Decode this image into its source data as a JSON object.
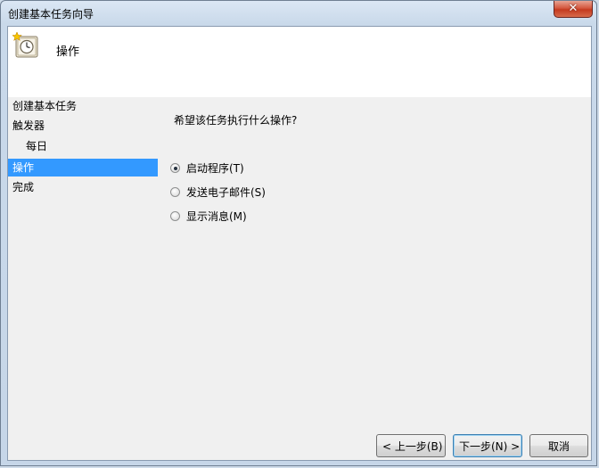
{
  "window": {
    "title": "创建基本任务向导",
    "close_label": "✕"
  },
  "header": {
    "title": "操作",
    "icon": "clock-star-icon"
  },
  "nav": {
    "items": [
      {
        "label": "创建基本任务"
      },
      {
        "label": "触发器"
      },
      {
        "label": "每日"
      },
      {
        "label": "操作"
      },
      {
        "label": "完成"
      }
    ]
  },
  "main": {
    "question": "希望该任务执行什么操作?",
    "options": [
      {
        "label": "启动程序(T)",
        "checked": true
      },
      {
        "label": "发送电子邮件(S)",
        "checked": false
      },
      {
        "label": "显示消息(M)",
        "checked": false
      }
    ]
  },
  "buttons": {
    "back": "< 上一步(B)",
    "next": "下一步(N) >",
    "cancel": "取消"
  },
  "colors": {
    "selection": "#3399ff",
    "client_bg": "#f0f0f0",
    "header_bg": "#ffffff"
  }
}
